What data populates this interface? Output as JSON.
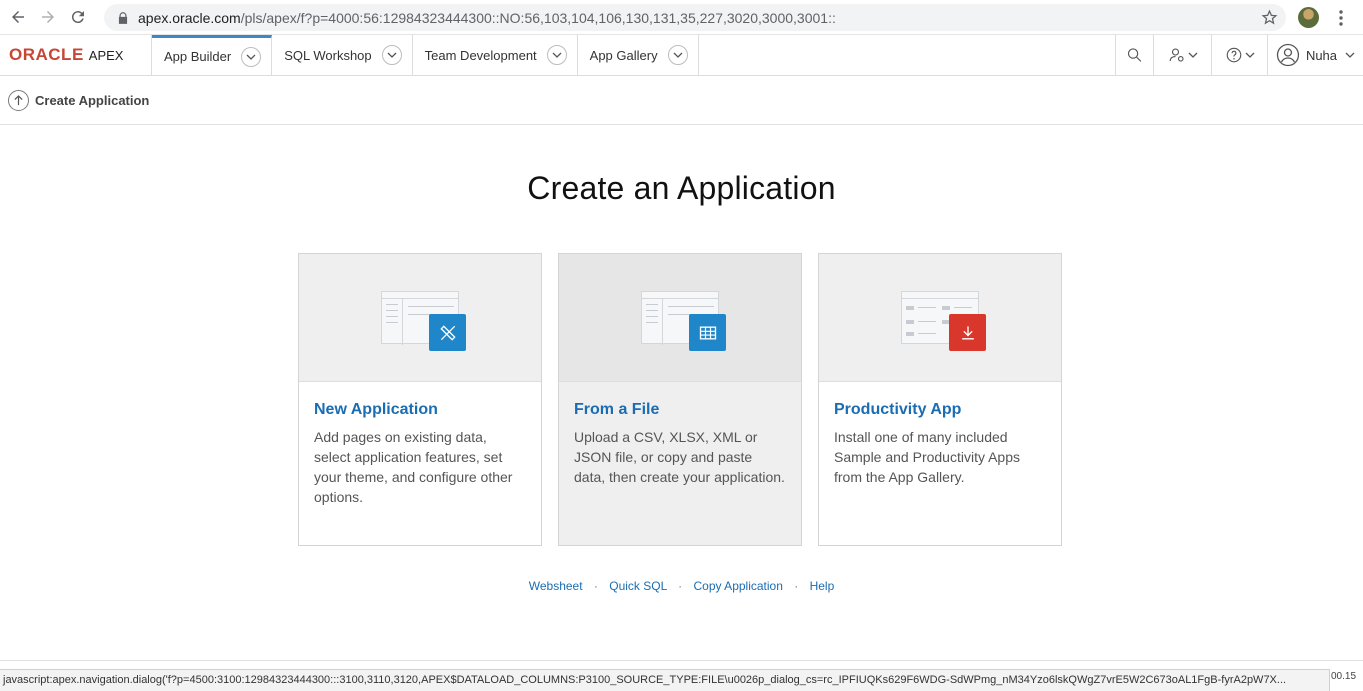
{
  "browser": {
    "url_host": "apex.oracle.com",
    "url_path": "/pls/apex/f?p=4000:56:12984323444300::NO:56,103,104,106,130,131,35,227,3020,3000,3001::"
  },
  "header": {
    "brand_oracle": "ORACLE",
    "brand_apex": "APEX",
    "tabs": [
      {
        "label": "App Builder"
      },
      {
        "label": "SQL Workshop"
      },
      {
        "label": "Team Development"
      },
      {
        "label": "App Gallery"
      }
    ],
    "user_name": "Nuha"
  },
  "breadcrumb": {
    "label": "Create Application"
  },
  "main": {
    "title": "Create an Application",
    "cards": [
      {
        "title": "New Application",
        "description": "Add pages on existing data, select application features, set your theme, and configure other options.",
        "icon": "tools-icon",
        "color": "#1f86c9"
      },
      {
        "title": "From a File",
        "description": "Upload a CSV, XLSX, XML or JSON file, or copy and paste data, then create your application.",
        "icon": "table-grid-icon",
        "color": "#1f86c9"
      },
      {
        "title": "Productivity App",
        "description": "Install one of many included Sample and Productivity Apps from the App Gallery.",
        "icon": "download-icon",
        "color": "#d9372b"
      }
    ],
    "footer_links": [
      {
        "label": "Websheet"
      },
      {
        "label": "Quick SQL"
      },
      {
        "label": "Copy Application"
      },
      {
        "label": "Help"
      }
    ]
  },
  "status_bar": {
    "link_preview": "javascript:apex.navigation.dialog('f?p=4500:3100:12984323444300:::3100,3110,3120,APEX$DATALOAD_COLUMNS:P3100_SOURCE_TYPE:FILE\\u0026p_dialog_cs=rc_IPFIUQKs629F6WDG-SdWPmg_nM34Yzo6lskQWgZ7vrE5W2C673oAL1FgB-fyrA2pW7X...",
    "right_fragment": "00.15"
  }
}
